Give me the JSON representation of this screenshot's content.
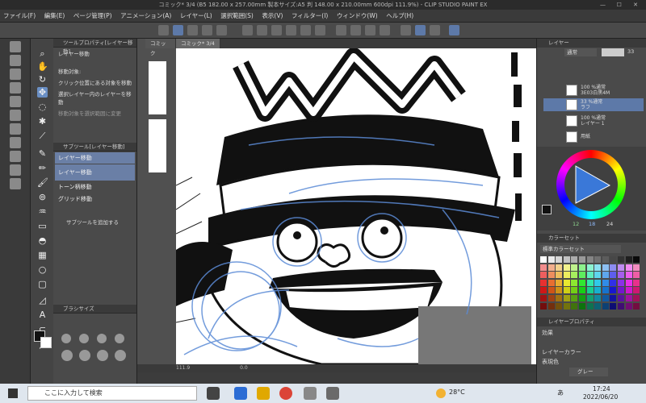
{
  "window": {
    "title": "コミック* 3/4 (B5 182.00 x 257.00mm 製本サイズ:A5 判 148.00 x 210.00mm 600dpi 111.9%) - CLIP STUDIO PAINT EX",
    "minimize": "—",
    "maximize": "☐",
    "close": "✕"
  },
  "menu": [
    "ファイル(F)",
    "編集(E)",
    "ページ管理(P)",
    "アニメーション(A)",
    "レイヤー(L)",
    "選択範囲(S)",
    "表示(V)",
    "フィルター(I)",
    "ウィンドウ(W)",
    "ヘルプ(H)"
  ],
  "tool_property": {
    "header": "ツールプロパティ[レイヤー移動]",
    "tool_name": "レイヤー移動",
    "move_target_label": "移動対象:",
    "options": [
      "クリック位置にある対象を移動",
      "選択レイヤー内のレイヤーを移動",
      "移動対象を選択範囲に変更"
    ]
  },
  "sub_tool": {
    "header": "サブツール[レイヤー移動]",
    "items": [
      "レイヤー移動",
      "レイヤー移動",
      "トーン柄移動",
      "グリッド移動"
    ],
    "add_label": "サブツールを追加する"
  },
  "brush_size_header": "ブラシサイズ",
  "canvas_tabs": [
    "コミック",
    "コミック* 3/4"
  ],
  "status": {
    "zoom": "111.9",
    "rotation": "0.0"
  },
  "layer_panel": {
    "header": "レイヤー",
    "blend_mode": "通常",
    "opacity": "33",
    "layers": [
      {
        "name": "100 %通常",
        "sub": "3E03白黒4M"
      },
      {
        "name": "33 %通常",
        "sub": "ラフ"
      },
      {
        "name": "100 %通常",
        "sub": "レイヤー 1"
      },
      {
        "name": "用紙",
        "sub": ""
      }
    ]
  },
  "color_wheel": {
    "h": "12",
    "s": "18",
    "v": "24"
  },
  "color_set": {
    "header": "カラーセット",
    "name": "標準カラーセット"
  },
  "layer_property": {
    "header": "レイヤープロパティ",
    "effect_label": "効果",
    "layer_color_label": "レイヤーカラー",
    "expression_label": "表現色",
    "expression_value": "グレー"
  },
  "taskbar": {
    "search_placeholder": "ここに入力して検索",
    "weather": "28°C",
    "ime": "あ",
    "time": "17:24",
    "date": "2022/06/20"
  },
  "colors": {
    "accent": "#5d79a8",
    "sketch_blue": "#5b8bd6"
  }
}
